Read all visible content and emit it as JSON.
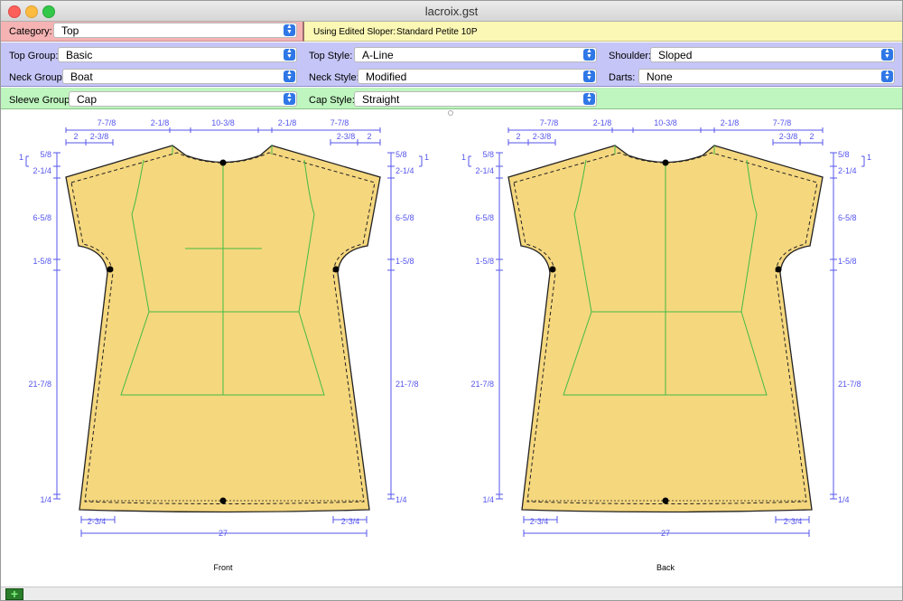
{
  "window": {
    "title": "lacroix.gst"
  },
  "category": {
    "label": "Category:",
    "value": "Top"
  },
  "sloper": {
    "label": "Using Edited Sloper:",
    "value": "Standard Petite 10P"
  },
  "row1": {
    "top_group": {
      "label": "Top Group:",
      "value": "Basic"
    },
    "top_style": {
      "label": "Top Style:",
      "value": "A-Line"
    },
    "shoulder": {
      "label": "Shoulder:",
      "value": "Sloped"
    }
  },
  "row2": {
    "neck_group": {
      "label": "Neck Group:",
      "value": "Boat"
    },
    "neck_style": {
      "label": "Neck Style:",
      "value": "Modified"
    },
    "darts": {
      "label": "Darts:",
      "value": "None"
    }
  },
  "row3": {
    "sleeve_group": {
      "label": "Sleeve Group:",
      "value": "Cap"
    },
    "cap_style": {
      "label": "Cap Style:",
      "value": "Straight"
    }
  },
  "pattern": {
    "top_dims": [
      "7-7/8",
      "2-1/8",
      "10-3/8",
      "2-1/8",
      "7-7/8"
    ],
    "sub_dims_left": [
      "2",
      "2-3/8"
    ],
    "sub_dims_right": [
      "2-3/8",
      "2"
    ],
    "side_dims": [
      "5/8",
      "2-1/4",
      "6-5/8",
      "1-5/8",
      "21-7/8",
      "1/4"
    ],
    "side_small": "1",
    "bottom_small": "2-3/4",
    "bottom_total": "27",
    "front_label": "Front",
    "back_label": "Back"
  },
  "colors": {
    "category_band": "#f5b3b3",
    "sloper_band": "#fbf7b4",
    "style_band": "#c5c5f7",
    "sleeve_band": "#bff5bf",
    "garment_fill": "#f5d77e",
    "dimension_blue": "#5555ee",
    "guide_green": "#44bb44"
  },
  "icons": {
    "add": "plus-icon",
    "select": "updown-arrows-icon"
  }
}
